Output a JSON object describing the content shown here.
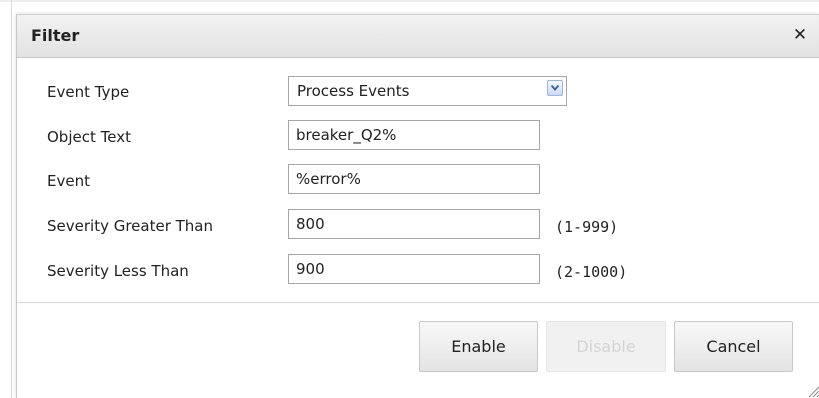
{
  "dialog": {
    "title": "Filter",
    "close_icon": "close-icon",
    "close_glyph": "✕"
  },
  "form": {
    "event_type": {
      "label": "Event Type",
      "value": "Process Events",
      "arrow_icon": "chevron-down-icon"
    },
    "object_text": {
      "label": "Object Text",
      "value": "breaker_Q2%"
    },
    "event": {
      "label": "Event",
      "value": "%error%"
    },
    "severity_greater": {
      "label": "Severity Greater Than",
      "value": "800",
      "range": "(1-999)"
    },
    "severity_less": {
      "label": "Severity Less Than",
      "value": "900",
      "range": "(2-1000)"
    }
  },
  "buttons": {
    "enable": "Enable",
    "disable": "Disable",
    "cancel": "Cancel"
  },
  "colors": {
    "titlebar": "#e8e8e8",
    "border": "#a7a7a7",
    "disabled_text": "#d4d4d4"
  }
}
